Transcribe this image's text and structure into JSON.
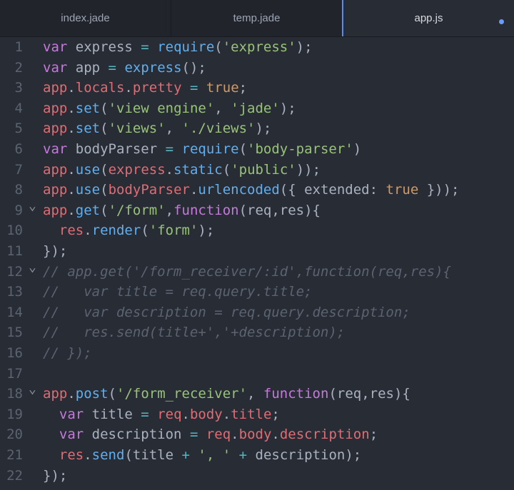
{
  "tabs": [
    {
      "label": "index.jade",
      "active": false
    },
    {
      "label": "temp.jade",
      "active": false
    },
    {
      "label": "app.js",
      "active": true,
      "modified": true
    }
  ],
  "colors": {
    "keyword": "#c678dd",
    "plain": "#abb2bf",
    "variable": "#e06c75",
    "function": "#61afef",
    "string": "#98c379",
    "constant": "#d19a66",
    "operator": "#56b6c2",
    "comment": "#5c6370",
    "accent": "#528bff"
  },
  "fold_icon": "chevron-down-icon",
  "lines": [
    {
      "number": "1",
      "tokens": [
        [
          "keyword",
          "var"
        ],
        [
          "plain",
          " express "
        ],
        [
          "operator",
          "="
        ],
        [
          "plain",
          " "
        ],
        [
          "function",
          "require"
        ],
        [
          "plain",
          "("
        ],
        [
          "string",
          "'express'"
        ],
        [
          "plain",
          ");"
        ]
      ]
    },
    {
      "number": "2",
      "tokens": [
        [
          "keyword",
          "var"
        ],
        [
          "plain",
          " app "
        ],
        [
          "operator",
          "="
        ],
        [
          "plain",
          " "
        ],
        [
          "function",
          "express"
        ],
        [
          "plain",
          "();"
        ]
      ]
    },
    {
      "number": "3",
      "tokens": [
        [
          "variable",
          "app"
        ],
        [
          "plain",
          "."
        ],
        [
          "variable",
          "locals"
        ],
        [
          "plain",
          "."
        ],
        [
          "variable",
          "pretty"
        ],
        [
          "plain",
          " "
        ],
        [
          "operator",
          "="
        ],
        [
          "plain",
          " "
        ],
        [
          "constant",
          "true"
        ],
        [
          "plain",
          ";"
        ]
      ]
    },
    {
      "number": "4",
      "tokens": [
        [
          "variable",
          "app"
        ],
        [
          "plain",
          "."
        ],
        [
          "function",
          "set"
        ],
        [
          "plain",
          "("
        ],
        [
          "string",
          "'view engine'"
        ],
        [
          "plain",
          ", "
        ],
        [
          "string",
          "'jade'"
        ],
        [
          "plain",
          ");"
        ]
      ]
    },
    {
      "number": "5",
      "tokens": [
        [
          "variable",
          "app"
        ],
        [
          "plain",
          "."
        ],
        [
          "function",
          "set"
        ],
        [
          "plain",
          "("
        ],
        [
          "string",
          "'views'"
        ],
        [
          "plain",
          ", "
        ],
        [
          "string",
          "'./views'"
        ],
        [
          "plain",
          ");"
        ]
      ]
    },
    {
      "number": "6",
      "tokens": [
        [
          "keyword",
          "var"
        ],
        [
          "plain",
          " bodyParser "
        ],
        [
          "operator",
          "="
        ],
        [
          "plain",
          " "
        ],
        [
          "function",
          "require"
        ],
        [
          "plain",
          "("
        ],
        [
          "string",
          "'body-parser'"
        ],
        [
          "plain",
          ")"
        ]
      ]
    },
    {
      "number": "7",
      "tokens": [
        [
          "variable",
          "app"
        ],
        [
          "plain",
          "."
        ],
        [
          "function",
          "use"
        ],
        [
          "plain",
          "("
        ],
        [
          "variable",
          "express"
        ],
        [
          "plain",
          "."
        ],
        [
          "function",
          "static"
        ],
        [
          "plain",
          "("
        ],
        [
          "string",
          "'public'"
        ],
        [
          "plain",
          "));"
        ]
      ]
    },
    {
      "number": "8",
      "tokens": [
        [
          "variable",
          "app"
        ],
        [
          "plain",
          "."
        ],
        [
          "function",
          "use"
        ],
        [
          "plain",
          "("
        ],
        [
          "variable",
          "bodyParser"
        ],
        [
          "plain",
          "."
        ],
        [
          "function",
          "urlencoded"
        ],
        [
          "plain",
          "({ extended: "
        ],
        [
          "constant",
          "true"
        ],
        [
          "plain",
          " }));"
        ]
      ]
    },
    {
      "number": "9",
      "fold": true,
      "tokens": [
        [
          "variable",
          "app"
        ],
        [
          "plain",
          "."
        ],
        [
          "function",
          "get"
        ],
        [
          "plain",
          "("
        ],
        [
          "string",
          "'/form'"
        ],
        [
          "plain",
          ","
        ],
        [
          "keyword",
          "function"
        ],
        [
          "plain",
          "(req,res){"
        ]
      ]
    },
    {
      "number": "10",
      "tokens": [
        [
          "plain",
          "  "
        ],
        [
          "variable",
          "res"
        ],
        [
          "plain",
          "."
        ],
        [
          "function",
          "render"
        ],
        [
          "plain",
          "("
        ],
        [
          "string",
          "'form'"
        ],
        [
          "plain",
          ");"
        ]
      ]
    },
    {
      "number": "11",
      "tokens": [
        [
          "plain",
          "});"
        ]
      ]
    },
    {
      "number": "12",
      "fold": true,
      "tokens": [
        [
          "comment",
          "// app.get('/form_receiver/:id',function(req,res){"
        ]
      ]
    },
    {
      "number": "13",
      "tokens": [
        [
          "comment",
          "//   var title = req.query.title;"
        ]
      ]
    },
    {
      "number": "14",
      "tokens": [
        [
          "comment",
          "//   var description = req.query.description;"
        ]
      ]
    },
    {
      "number": "15",
      "tokens": [
        [
          "comment",
          "//   res.send(title+','+description);"
        ]
      ]
    },
    {
      "number": "16",
      "tokens": [
        [
          "comment",
          "// });"
        ]
      ]
    },
    {
      "number": "17",
      "tokens": []
    },
    {
      "number": "18",
      "fold": true,
      "tokens": [
        [
          "variable",
          "app"
        ],
        [
          "plain",
          "."
        ],
        [
          "function",
          "post"
        ],
        [
          "plain",
          "("
        ],
        [
          "string",
          "'/form_receiver'"
        ],
        [
          "plain",
          ", "
        ],
        [
          "keyword",
          "function"
        ],
        [
          "plain",
          "(req,res){"
        ]
      ]
    },
    {
      "number": "19",
      "tokens": [
        [
          "plain",
          "  "
        ],
        [
          "keyword",
          "var"
        ],
        [
          "plain",
          " title "
        ],
        [
          "operator",
          "="
        ],
        [
          "plain",
          " "
        ],
        [
          "variable",
          "req"
        ],
        [
          "plain",
          "."
        ],
        [
          "variable",
          "body"
        ],
        [
          "plain",
          "."
        ],
        [
          "variable",
          "title"
        ],
        [
          "plain",
          ";"
        ]
      ]
    },
    {
      "number": "20",
      "tokens": [
        [
          "plain",
          "  "
        ],
        [
          "keyword",
          "var"
        ],
        [
          "plain",
          " description "
        ],
        [
          "operator",
          "="
        ],
        [
          "plain",
          " "
        ],
        [
          "variable",
          "req"
        ],
        [
          "plain",
          "."
        ],
        [
          "variable",
          "body"
        ],
        [
          "plain",
          "."
        ],
        [
          "variable",
          "description"
        ],
        [
          "plain",
          ";"
        ]
      ]
    },
    {
      "number": "21",
      "tokens": [
        [
          "plain",
          "  "
        ],
        [
          "variable",
          "res"
        ],
        [
          "plain",
          "."
        ],
        [
          "function",
          "send"
        ],
        [
          "plain",
          "(title "
        ],
        [
          "operator",
          "+"
        ],
        [
          "plain",
          " "
        ],
        [
          "string",
          "', '"
        ],
        [
          "plain",
          " "
        ],
        [
          "operator",
          "+"
        ],
        [
          "plain",
          " description);"
        ]
      ]
    },
    {
      "number": "22",
      "tokens": [
        [
          "plain",
          "});"
        ]
      ]
    }
  ]
}
